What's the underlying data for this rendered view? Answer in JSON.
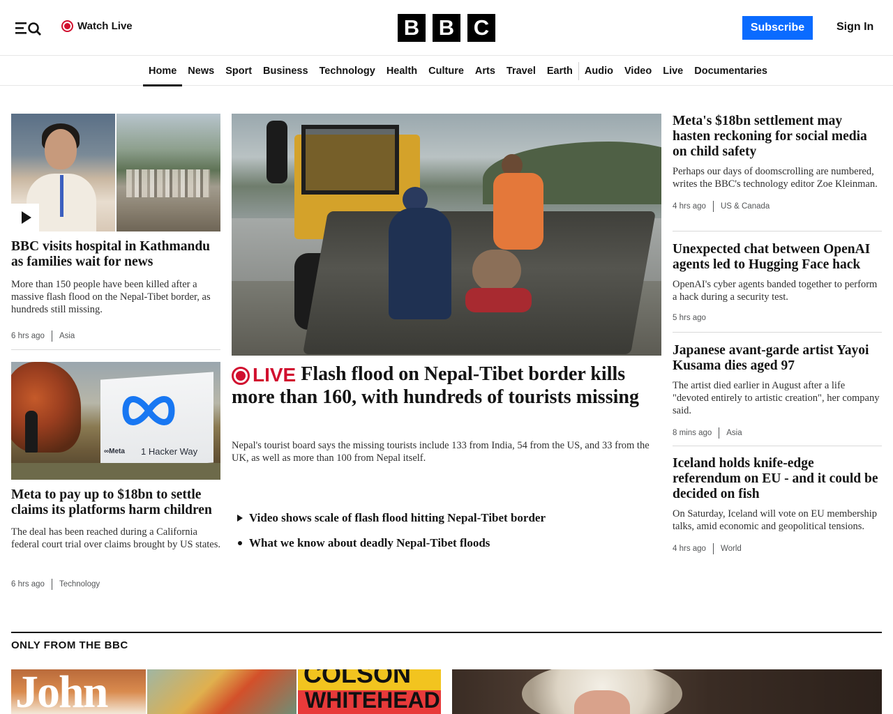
{
  "header": {
    "watch_live_label": "Watch Live",
    "logo_letters": [
      "B",
      "B",
      "C"
    ],
    "subscribe_label": "Subscribe",
    "signin_label": "Sign In"
  },
  "nav": {
    "items": [
      "Home",
      "News",
      "Sport",
      "Business",
      "Technology",
      "Health",
      "Culture",
      "Arts",
      "Travel",
      "Earth",
      "Audio",
      "Video",
      "Live",
      "Documentaries"
    ],
    "active": "Home"
  },
  "left": {
    "story1": {
      "title": "BBC visits hospital in Kathmandu as families wait for news",
      "desc": "More than 150 people have been killed after a massive flash flood on the Nepal-Tibet border, as hundreds still missing.",
      "time": "6 hrs ago",
      "category": "Asia"
    },
    "story2": {
      "image_text_a": "∞Meta",
      "image_text_b": "1 Hacker Way",
      "title": "Meta to pay up to $18bn to settle claims its platforms harm children",
      "desc": "The deal has been reached during a California federal court trial over claims brought by US states.",
      "time": "6 hrs ago",
      "category": "Technology"
    }
  },
  "center": {
    "live_label": "LIVE",
    "title": "Flash flood on Nepal-Tibet border kills more than 160, with hundreds of tourists missing",
    "desc": "Nepal's tourist board says the missing tourists include 133 from India, 54 from the US, and 33 from the UK, as well as more than 100 from Nepal itself.",
    "related": [
      {
        "type": "video",
        "label": "Video shows scale of flash flood hitting Nepal-Tibet border"
      },
      {
        "type": "bullet",
        "label": "What we know about deadly Nepal-Tibet floods"
      }
    ]
  },
  "right": {
    "stories": [
      {
        "title": "Meta's $18bn settlement may hasten reckoning for social media on child safety",
        "desc": "Perhaps our days of doomscrolling are numbered, writes the BBC's technology editor Zoe Kleinman.",
        "time": "4 hrs ago",
        "category": "US & Canada"
      },
      {
        "title": "Unexpected chat between OpenAI agents led to Hugging Face hack",
        "desc": "OpenAI's cyber agents banded together to perform a hack during a security test.",
        "time": "5 hrs ago",
        "category": ""
      },
      {
        "title": "Japanese avant-garde artist Yayoi Kusama dies aged 97",
        "desc": "The artist died earlier in August after a life \"devoted entirely to artistic creation\", her company said.",
        "time": "8 mins ago",
        "category": "Asia"
      },
      {
        "title": "Iceland holds knife-edge referendum on EU - and it could be decided on fish",
        "desc": "On Saturday, Iceland will vote on EU membership talks, amid economic and geopolitical tensions.",
        "time": "4 hrs ago",
        "category": "World"
      }
    ]
  },
  "only_from_bbc": {
    "title": "ONLY FROM THE BBC",
    "book1_text": "John",
    "book3_text_a": "COLSON",
    "book3_text_b": "WHITEHEAD"
  },
  "colors": {
    "accent_blue": "#0a6bff",
    "live_red": "#d1102f",
    "text": "#141414"
  }
}
